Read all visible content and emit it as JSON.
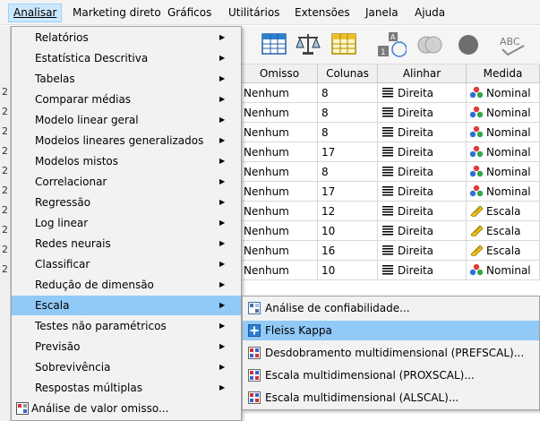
{
  "menubar": {
    "items": [
      {
        "label": "Analisar",
        "active": true
      },
      {
        "label": "Marketing direto"
      },
      {
        "label": "Gráficos"
      },
      {
        "label": "Utilitários"
      },
      {
        "label": "Extensões"
      },
      {
        "label": "Janela"
      },
      {
        "label": "Ajuda"
      }
    ]
  },
  "grid": {
    "headers": [
      "Omisso",
      "Colunas",
      "Alinhar",
      "Medida"
    ],
    "rows": [
      {
        "omisso": "Nenhum",
        "colunas": "8",
        "alinhar": "Direita",
        "medida": "Nominal",
        "icon": "nominal"
      },
      {
        "omisso": "Nenhum",
        "colunas": "8",
        "alinhar": "Direita",
        "medida": "Nominal",
        "icon": "nominal"
      },
      {
        "omisso": "Nenhum",
        "colunas": "8",
        "alinhar": "Direita",
        "medida": "Nominal",
        "icon": "nominal"
      },
      {
        "omisso": "Nenhum",
        "colunas": "17",
        "alinhar": "Direita",
        "medida": "Nominal",
        "icon": "nominal"
      },
      {
        "omisso": "Nenhum",
        "colunas": "8",
        "alinhar": "Direita",
        "medida": "Nominal",
        "icon": "nominal"
      },
      {
        "omisso": "Nenhum",
        "colunas": "17",
        "alinhar": "Direita",
        "medida": "Nominal",
        "icon": "nominal"
      },
      {
        "omisso": "Nenhum",
        "colunas": "12",
        "alinhar": "Direita",
        "medida": "Escala",
        "icon": "scale"
      },
      {
        "omisso": "Nenhum",
        "colunas": "10",
        "alinhar": "Direita",
        "medida": "Escala",
        "icon": "scale"
      },
      {
        "omisso": "Nenhum",
        "colunas": "16",
        "alinhar": "Direita",
        "medida": "Escala",
        "icon": "scale"
      },
      {
        "omisso": "Nenhum",
        "colunas": "10",
        "alinhar": "Direita",
        "medida": "Nominal",
        "icon": "nominal"
      }
    ]
  },
  "rownums": [
    "2",
    "2",
    "2",
    "2",
    "2",
    "2",
    "2",
    "2",
    "2",
    "2"
  ],
  "menu": {
    "items": [
      {
        "label": "Relatórios",
        "arrow": true
      },
      {
        "label": "Estatística Descritiva",
        "arrow": true
      },
      {
        "label": "Tabelas",
        "arrow": true
      },
      {
        "label": "Comparar médias",
        "arrow": true
      },
      {
        "label": "Modelo linear geral",
        "arrow": true
      },
      {
        "label": "Modelos lineares generalizados",
        "arrow": true
      },
      {
        "label": "Modelos mistos",
        "arrow": true
      },
      {
        "label": "Correlacionar",
        "arrow": true
      },
      {
        "label": "Regressão",
        "arrow": true
      },
      {
        "label": "Log linear",
        "arrow": true
      },
      {
        "label": "Redes neurais",
        "arrow": true
      },
      {
        "label": "Classificar",
        "arrow": true
      },
      {
        "label": "Redução de dimensão",
        "arrow": true
      },
      {
        "label": "Escala",
        "arrow": true,
        "selected": true
      },
      {
        "label": "Testes não paramétricos",
        "arrow": true
      },
      {
        "label": "Previsão",
        "arrow": true
      },
      {
        "label": "Sobrevivência",
        "arrow": true
      },
      {
        "label": "Respostas múltiplas",
        "arrow": true
      },
      {
        "label": "Análise de valor omisso...",
        "arrow": false,
        "icon": true
      }
    ]
  },
  "submenu": {
    "items": [
      {
        "label": "Análise de confiabilidade..."
      },
      {
        "label": "Fleiss Kappa",
        "selected": true
      },
      {
        "label": "Desdobramento multidimensional (PREFSCAL)..."
      },
      {
        "label": "Escala multidimensional (PROXSCAL)..."
      },
      {
        "label": "Escala multidimensional (ALSCAL)..."
      }
    ]
  },
  "colors": {
    "selection": "#91c9f7",
    "menu_bg": "#f2f2f2",
    "active_menubar": "#cce8ff"
  }
}
